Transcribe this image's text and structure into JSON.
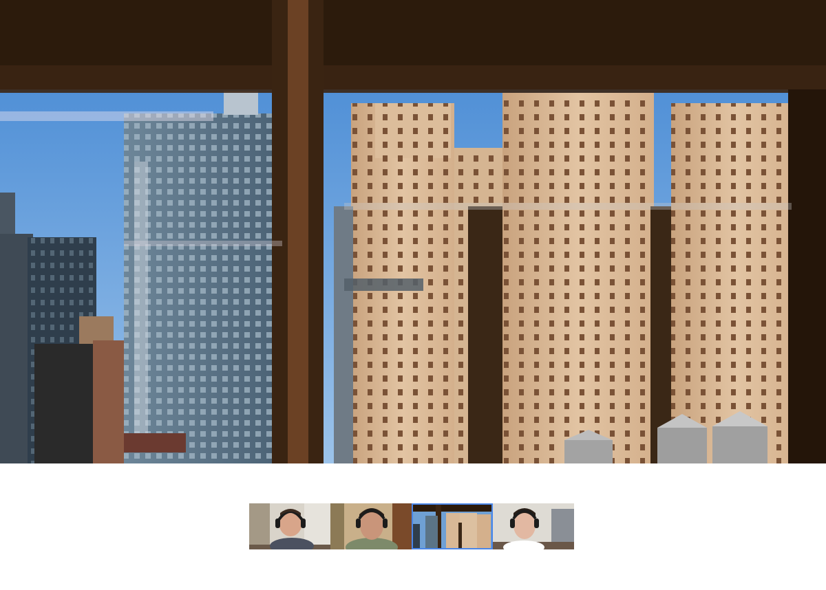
{
  "call": {
    "main_feed": "window-skyline",
    "active_participant_index": 2
  },
  "participants": [
    {
      "id": "p1",
      "feed": "person-headset-office"
    },
    {
      "id": "p2",
      "feed": "person-headset-home"
    },
    {
      "id": "p3",
      "feed": "window-skyline",
      "active": true
    },
    {
      "id": "p4",
      "feed": "person-headset-office-2"
    }
  ],
  "colors": {
    "active_outline": "#4a86e8",
    "background": "#ffffff",
    "sky": "#7fb0e0",
    "building_tan": "#d8b896",
    "window_frame": "#3a2412"
  }
}
